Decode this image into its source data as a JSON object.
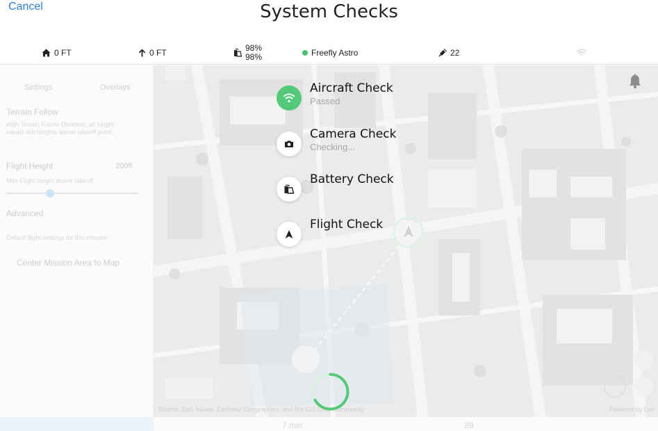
{
  "header": {
    "cancel_label": "Cancel",
    "title": "System Checks"
  },
  "status": {
    "home_altitude": "0 FT",
    "altitude": "0 FT",
    "battery_1": "98%",
    "battery_2": "98%",
    "aircraft_name": "Freefly Astro",
    "aircraft_status_color": "#45c46f",
    "satellites": "22",
    "icons": [
      "home-icon",
      "arrow-up-icon",
      "battery-icon",
      "satellite-icon",
      "wifi-icon"
    ]
  },
  "left_panel": {
    "tabs": [
      "Settings",
      "Overlays"
    ],
    "terrain_follow": "Terrain Follow",
    "terrain_desc": "With Terrain Follow Disabled, all height values are heights above takeoff point.",
    "flight_height_label": "Flight Height",
    "flight_height_value": "200ft",
    "flight_height_desc": "Max Flight height above takeoff",
    "advanced": "Advanced",
    "advanced_desc": "Default flight settings for this mission",
    "center_button": "Center Mission Area to Map"
  },
  "checks": [
    {
      "title": "Aircraft Check",
      "status": "Passed",
      "icon": "wifi-icon",
      "state": "passed"
    },
    {
      "title": "Camera Check",
      "status": "Checking...",
      "icon": "camera-icon",
      "state": "checking"
    },
    {
      "title": "Battery Check",
      "status": "",
      "icon": "battery-icon",
      "state": "pending"
    },
    {
      "title": "Flight Check",
      "status": "",
      "icon": "navigation-arrow-icon",
      "state": "pending"
    }
  ],
  "map": {
    "source": "Source: Esri, Maxar, Earthstar Geographics, and the GIS User Community",
    "powered_by": "Powered by Esri",
    "duration": "7 min",
    "photo_count": "29",
    "accent_color": "#54c97a"
  }
}
